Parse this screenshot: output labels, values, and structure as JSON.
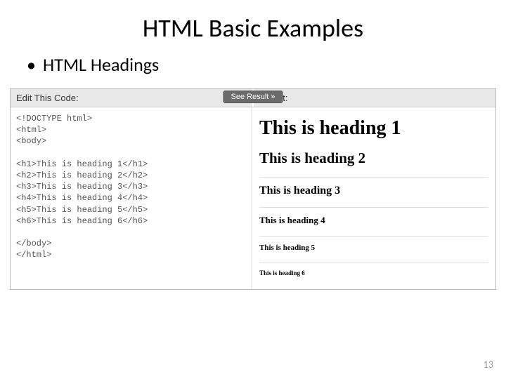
{
  "slide": {
    "title": "HTML Basic Examples",
    "bullet": "HTML Headings",
    "pageNumber": "13"
  },
  "editor": {
    "headerLeft": "Edit This Code:",
    "headerRight": "Result:",
    "seeResult": "See Result »",
    "code": "<!DOCTYPE html>\n<html>\n<body>\n\n<h1>This is heading 1</h1>\n<h2>This is heading 2</h2>\n<h3>This is heading 3</h3>\n<h4>This is heading 4</h4>\n<h5>This is heading 5</h5>\n<h6>This is heading 6</h6>\n\n</body>\n</html>"
  },
  "result": {
    "h1": "This is heading 1",
    "h2": "This is heading 2",
    "h3": "This is heading 3",
    "h4": "This is heading 4",
    "h5": "This is heading 5",
    "h6": "This is heading 6"
  }
}
